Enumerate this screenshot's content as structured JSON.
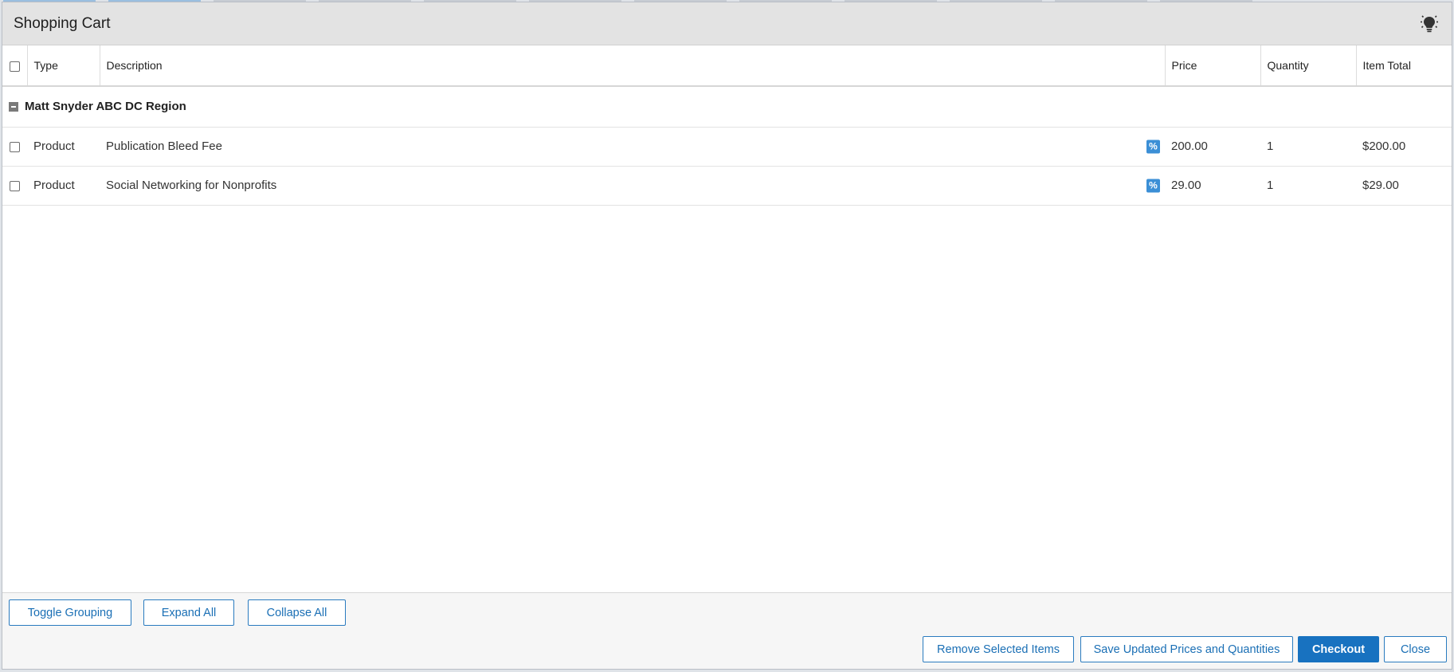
{
  "dialog": {
    "title": "Shopping Cart"
  },
  "columns": {
    "type": "Type",
    "description": "Description",
    "price": "Price",
    "quantity": "Quantity",
    "item_total": "Item Total"
  },
  "group": {
    "label": "Matt Snyder ABC DC Region"
  },
  "items": [
    {
      "type": "Product",
      "description": "Publication Bleed Fee",
      "discount_icon": "%",
      "price": "200.00",
      "quantity": "1",
      "item_total": "$200.00"
    },
    {
      "type": "Product",
      "description": "Social Networking for Nonprofits",
      "discount_icon": "%",
      "price": "29.00",
      "quantity": "1",
      "item_total": "$29.00"
    }
  ],
  "footer": {
    "toggle_grouping": "Toggle Grouping",
    "expand_all": "Expand All",
    "collapse_all": "Collapse All",
    "remove_selected": "Remove Selected Items",
    "save_updated": "Save Updated Prices and Quantities",
    "checkout": "Checkout",
    "close": "Close"
  },
  "colors": {
    "accent": "#1872c0",
    "discount_badge": "#3b8fd6",
    "title_bar": "#e3e3e3"
  },
  "icons": {
    "title": "lightbulb-icon",
    "discount": "percent-icon",
    "group": "collapse-icon"
  }
}
